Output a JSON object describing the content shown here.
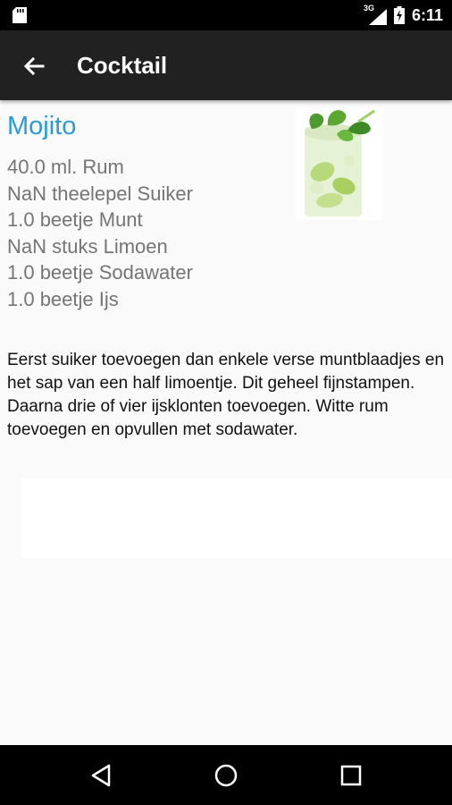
{
  "status_bar": {
    "network_type": "3G",
    "time": "6:11",
    "icons": [
      "sd-card-icon",
      "signal-icon",
      "battery-charging-icon"
    ]
  },
  "app_bar": {
    "title": "Cocktail",
    "back_icon": "arrow-back-icon"
  },
  "recipe": {
    "name": "Mojito",
    "ingredients": [
      "40.0 ml. Rum",
      "NaN theelepel Suiker",
      "1.0 beetje Munt",
      "NaN stuks Limoen",
      "1.0 beetje Sodawater",
      "1.0 beetje Ijs"
    ],
    "instructions": "Eerst suiker toevoegen dan enkele verse muntblaadjes en het sap van een half limoentje. Dit geheel fijnstampen. Daarna drie of vier ijsklonten toevoegen. Witte rum toevoegen en opvullen met sodawater."
  },
  "nav_bar": {
    "back": "triangle-back-icon",
    "home": "circle-home-icon",
    "recents": "square-recents-icon"
  },
  "colors": {
    "title_accent": "#2a9bd7",
    "app_bar": "#212121",
    "background": "#fafafa",
    "ingredient_text": "#757575"
  }
}
